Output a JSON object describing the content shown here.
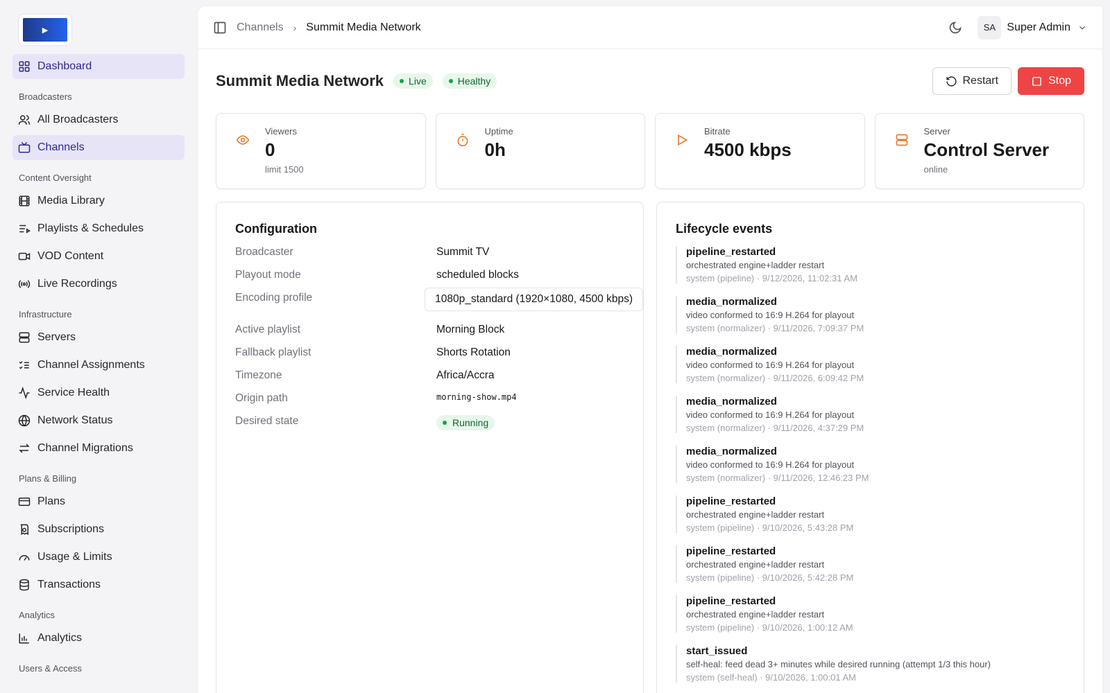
{
  "sidebar": {
    "dashboard": "Dashboard",
    "sections": {
      "broadcasters": "Broadcasters",
      "content": "Content Oversight",
      "infrastructure": "Infrastructure",
      "billing": "Plans & Billing",
      "analytics": "Analytics",
      "users": "Users & Access"
    },
    "items": {
      "all_broadcasters": "All Broadcasters",
      "channels": "Channels",
      "media_library": "Media Library",
      "playlists": "Playlists & Schedules",
      "vod": "VOD Content",
      "live_recordings": "Live Recordings",
      "servers": "Servers",
      "channel_assignments": "Channel Assignments",
      "service_health": "Service Health",
      "network_status": "Network Status",
      "channel_migrations": "Channel Migrations",
      "plans": "Plans",
      "subscriptions": "Subscriptions",
      "usage": "Usage & Limits",
      "transactions": "Transactions",
      "analytics": "Analytics"
    }
  },
  "header": {
    "breadcrumb_parent": "Channels",
    "breadcrumb_current": "Summit Media Network",
    "user_initials": "SA",
    "user_name": "Super Admin"
  },
  "page": {
    "title": "Summit Media Network",
    "badge_live": "Live",
    "badge_health": "Healthy",
    "restart_label": "Restart",
    "stop_label": "Stop"
  },
  "stats": {
    "viewers": {
      "label": "Viewers",
      "value": "0",
      "sub": "limit 1500"
    },
    "uptime": {
      "label": "Uptime",
      "value": "0h"
    },
    "bitrate": {
      "label": "Bitrate",
      "value": "4500 kbps"
    },
    "server": {
      "label": "Server",
      "value": "Control Server",
      "sub": "online"
    }
  },
  "config": {
    "title": "Configuration",
    "rows": {
      "broadcaster": {
        "key": "Broadcaster",
        "value": "Summit TV"
      },
      "playout": {
        "key": "Playout mode",
        "value": "scheduled blocks"
      },
      "encoding": {
        "key": "Encoding profile",
        "value": "1080p_standard (1920×1080, 4500 kbps)"
      },
      "active_playlist": {
        "key": "Active playlist",
        "value": "Morning Block"
      },
      "fallback_playlist": {
        "key": "Fallback playlist",
        "value": "Shorts Rotation"
      },
      "timezone": {
        "key": "Timezone",
        "value": "Africa/Accra"
      },
      "origin_path": {
        "key": "Origin path",
        "value": "morning-show.mp4"
      },
      "desired_state": {
        "key": "Desired state",
        "value": "Running"
      }
    }
  },
  "events": {
    "title": "Lifecycle events",
    "items": [
      {
        "name": "pipeline_restarted",
        "desc": "orchestrated engine+ladder restart",
        "meta": "system (pipeline) · 9/12/2026, 11:02:31 AM"
      },
      {
        "name": "media_normalized",
        "desc": "video conformed to 16:9 H.264 for playout",
        "meta": "system (normalizer) · 9/11/2026, 7:09:37 PM"
      },
      {
        "name": "media_normalized",
        "desc": "video conformed to 16:9 H.264 for playout",
        "meta": "system (normalizer) · 9/11/2026, 6:09:42 PM"
      },
      {
        "name": "media_normalized",
        "desc": "video conformed to 16:9 H.264 for playout",
        "meta": "system (normalizer) · 9/11/2026, 4:37:29 PM"
      },
      {
        "name": "media_normalized",
        "desc": "video conformed to 16:9 H.264 for playout",
        "meta": "system (normalizer) · 9/11/2026, 12:46:23 PM"
      },
      {
        "name": "pipeline_restarted",
        "desc": "orchestrated engine+ladder restart",
        "meta": "system (pipeline) · 9/10/2026, 5:43:28 PM"
      },
      {
        "name": "pipeline_restarted",
        "desc": "orchestrated engine+ladder restart",
        "meta": "system (pipeline) · 9/10/2026, 5:42:28 PM"
      },
      {
        "name": "pipeline_restarted",
        "desc": "orchestrated engine+ladder restart",
        "meta": "system (pipeline) · 9/10/2026, 1:00:12 AM"
      },
      {
        "name": "start_issued",
        "desc": "self-heal: feed dead 3+ minutes while desired running (attempt 1/3 this hour)",
        "meta": "system (self-heal) · 9/10/2026, 1:00:01 AM"
      }
    ]
  },
  "colors": {
    "accent": "#2e2a8c",
    "active_bg": "#e6e4f6",
    "danger": "#ef4444",
    "success": "#16a34a",
    "stat_icon": "#ea7a2e"
  }
}
